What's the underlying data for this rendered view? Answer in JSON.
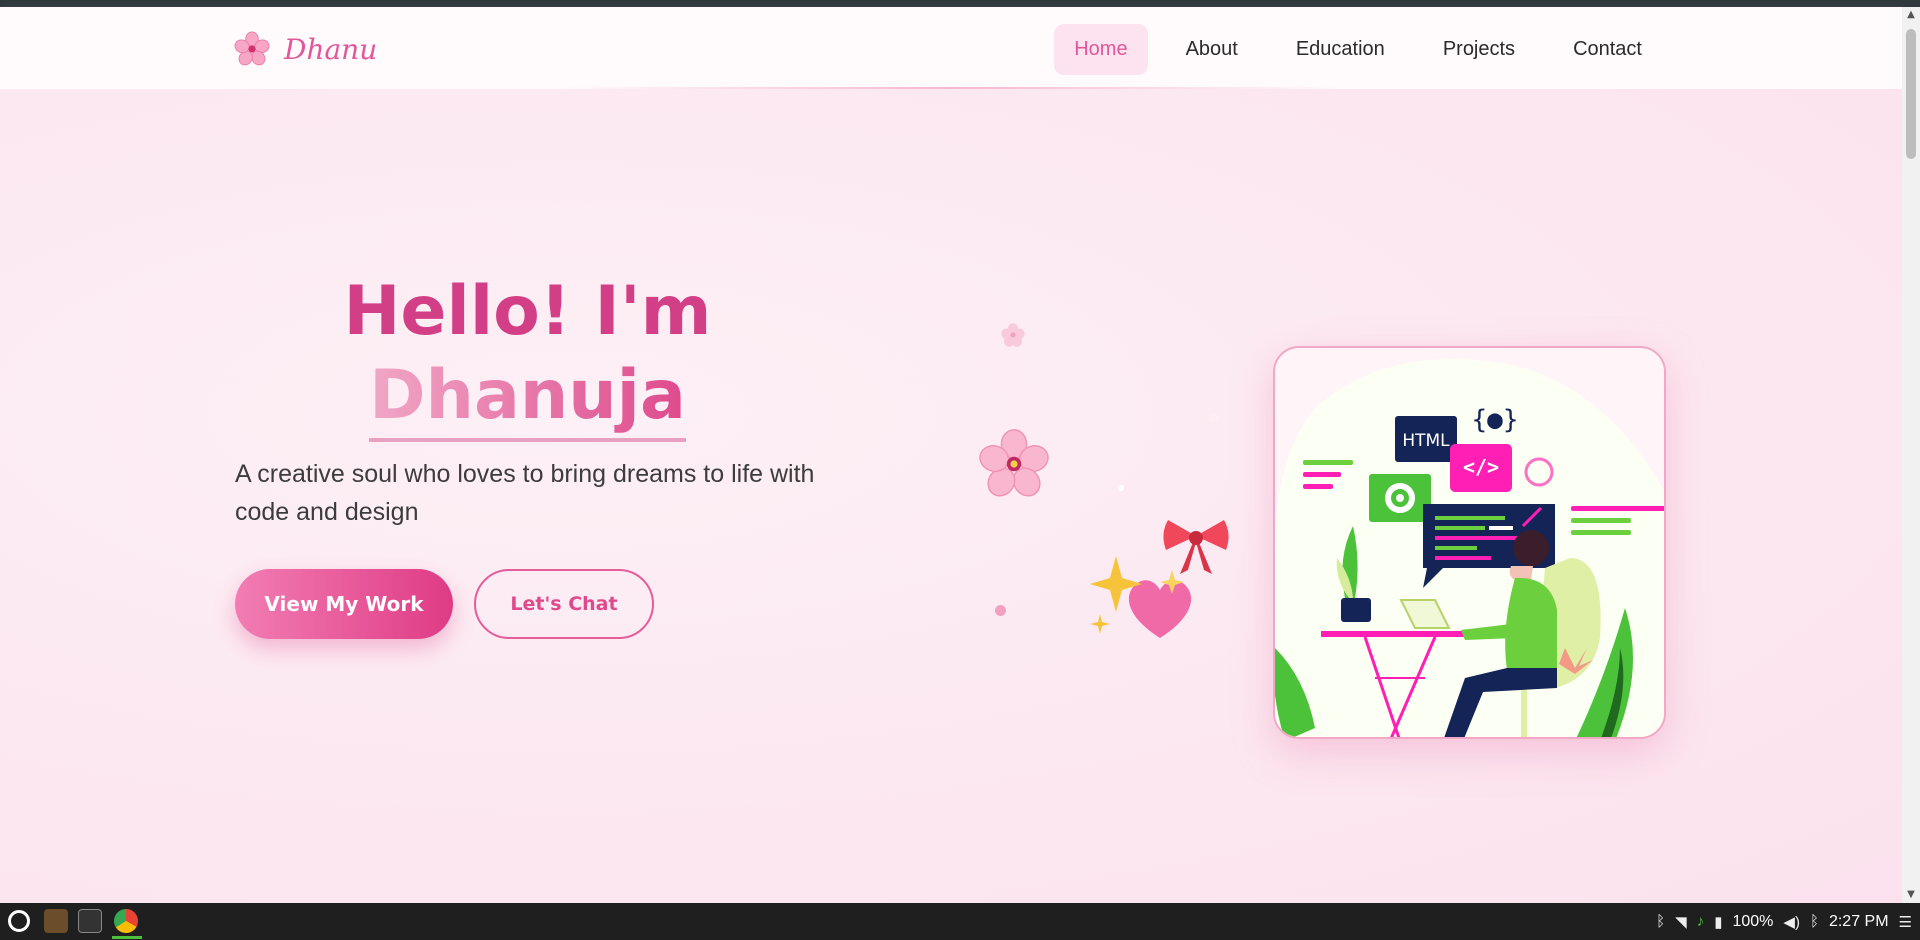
{
  "brand": {
    "name": "Dhanu",
    "logo_icon": "cherry-blossom-icon",
    "accent": "#e0579a"
  },
  "nav": {
    "items": [
      {
        "label": "Home",
        "active": true
      },
      {
        "label": "About",
        "active": false
      },
      {
        "label": "Education",
        "active": false
      },
      {
        "label": "Projects",
        "active": false
      },
      {
        "label": "Contact",
        "active": false
      }
    ]
  },
  "hero": {
    "greeting": "Hello! I'm",
    "name": "Dhanuja",
    "tagline": "A creative soul who loves to bring dreams to life with code and design",
    "primary_button": "View My Work",
    "secondary_button": "Let's Chat"
  },
  "illustration": {
    "html_badge": "HTML",
    "code_badge": "</>",
    "braces_badge": "{●}"
  },
  "taskbar": {
    "battery": "100%",
    "time": "2:27 PM"
  }
}
